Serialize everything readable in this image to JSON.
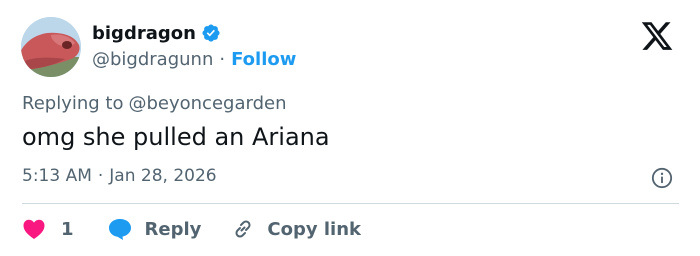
{
  "author": {
    "display_name": "bigdragon",
    "handle": "@bigdragunn",
    "separator": "·",
    "follow_label": "Follow"
  },
  "reply_context": {
    "prefix": "Replying to",
    "mention": "@beyoncegarden"
  },
  "tweet": {
    "text": "omg she pulled an Ariana"
  },
  "meta": {
    "time": "5:13 AM",
    "separator": "·",
    "date": "Jan 28, 2026"
  },
  "actions": {
    "like_count": "1",
    "reply_label": "Reply",
    "copy_link_label": "Copy link"
  },
  "icons": {
    "verified": "verified-badge-icon",
    "logo": "x-logo-icon",
    "info": "info-icon",
    "like": "heart-icon",
    "reply": "speech-bubble-icon",
    "copy": "link-icon"
  },
  "colors": {
    "accent": "#1d9bf0",
    "like": "#f91880",
    "text_primary": "#0f1419",
    "text_secondary": "#536471",
    "divider": "#cfd9de"
  }
}
